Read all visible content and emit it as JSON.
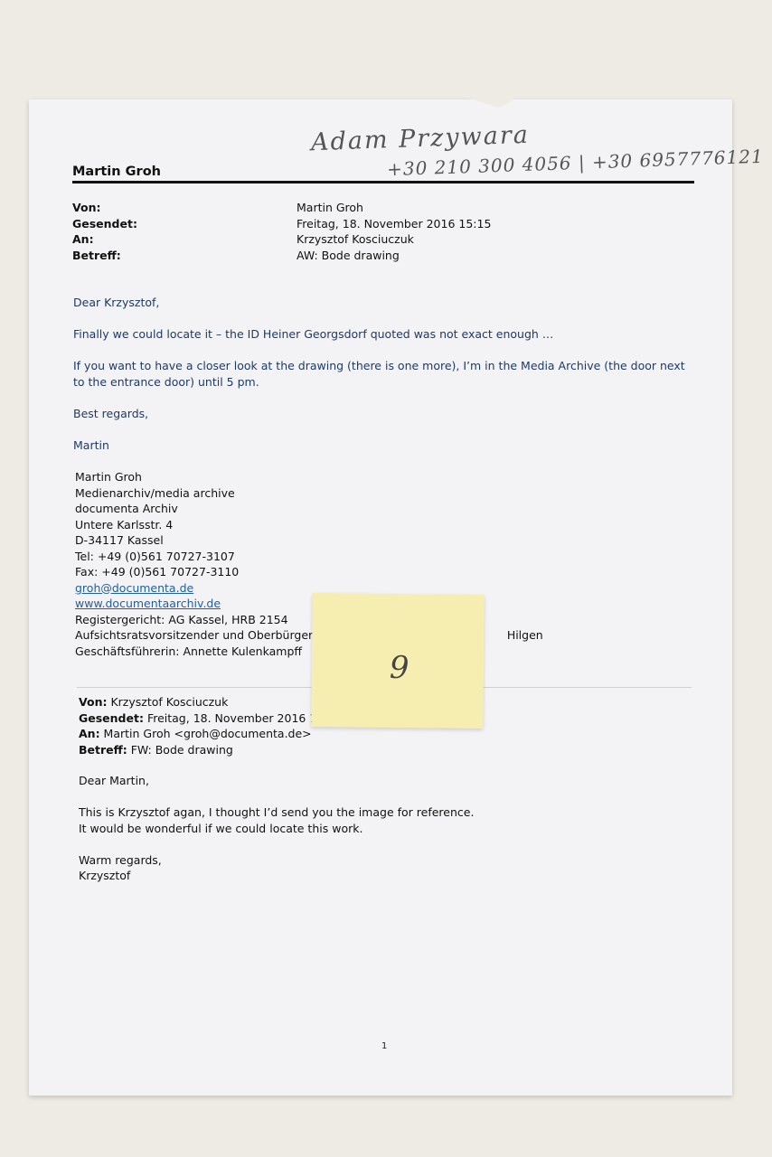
{
  "handwriting": {
    "name": "Adam Przywara",
    "phones": "+30 210 300 4056 | +30 6957776121"
  },
  "document": {
    "title": "Martin Groh",
    "header": [
      {
        "key": "Von:",
        "value": "Martin Groh"
      },
      {
        "key": "Gesendet:",
        "value": "Freitag, 18. November 2016 15:15"
      },
      {
        "key": "An:",
        "value": "Krzysztof Kosciuczuk"
      },
      {
        "key": "Betreff:",
        "value": "AW: Bode drawing"
      }
    ],
    "greeting": "Dear Krzysztof,",
    "paragraph1": "Finally we could locate it – the ID Heiner Georgsdorf quoted was not exact enough …",
    "paragraph2": "If you want to have a closer look at the drawing (there is one more), I’m in the Media Archive (the door next to the entrance door) until 5 pm.",
    "closing": "Best regards,",
    "signoff": "Martin",
    "signature": {
      "name": "Martin Groh",
      "department": "Medienarchiv/media archive",
      "org": "documenta Archiv",
      "street": "Untere Karlsstr. 4",
      "city": "D-34117 Kassel",
      "tel": "Tel:  +49 (0)561 70727-3107",
      "fax": "Fax: +49 (0)561 70727-3110",
      "email": "groh@documenta.de",
      "web": "www.documentaarchiv.de",
      "register": "Registergericht: AG Kassel, HRB 2154",
      "board": "Aufsichtsratsvorsitzender und Oberbürgerme",
      "board_tail": "Hilgen",
      "ceo": "Geschäftsführerin: Annette Kulenkampff"
    },
    "forwarded": {
      "from_label": "Von:",
      "from_value": " Krzysztof Kosciuczuk",
      "sent_label": "Gesendet:",
      "sent_value": " Freitag, 18. November 2016 13:3",
      "to_label": "An:",
      "to_value": " Martin Groh <groh@documenta.de>",
      "subject_label": "Betreff:",
      "subject_value": " FW: Bode drawing",
      "greeting": "Dear Martin,",
      "line1": "This is Krzysztof agan, I thought I’d send you the image for reference.",
      "line2": "It would be wonderful if we could locate this work.",
      "closing": "Warm regards,",
      "signoff": "Krzysztof"
    },
    "page_number": "1"
  },
  "sticky_note": {
    "number": "9"
  }
}
